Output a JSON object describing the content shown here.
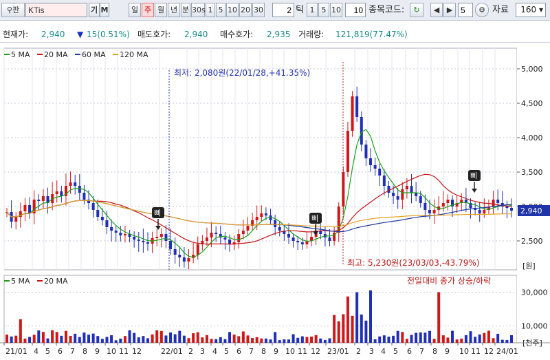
{
  "toolbar": {
    "search_icon_label": "ㅋ",
    "search_btn_label": "판",
    "stock_name": "KTis",
    "ki_label": "기",
    "m_label": "M",
    "period_buttons": [
      "일",
      "주",
      "월",
      "년",
      "분",
      "30s",
      "1",
      "5",
      "10",
      "20",
      "30"
    ],
    "active_period": "주",
    "count_value": "2",
    "tick_label": "틱",
    "tick_buttons": [
      "1",
      "5",
      "10"
    ],
    "tick_value": "10",
    "code_label": "종목코드:",
    "nav_value": "5",
    "data_label": "자료",
    "data_count": "160"
  },
  "info": {
    "price_label": "현재가:",
    "price": "2,940",
    "change": "15(0.51%)",
    "ask_label": "매도호가:",
    "ask": "2,940",
    "bid_label": "매수호가:",
    "bid": "2,935",
    "volume_label": "거래량:",
    "volume": "121,819(77.47%)"
  },
  "legend": {
    "ma": [
      {
        "label": "5 MA",
        "color": "#1aa01a"
      },
      {
        "label": "20 MA",
        "color": "#c41414"
      },
      {
        "label": "60 MA",
        "color": "#1f3a9e"
      },
      {
        "label": "120 MA",
        "color": "#e8a020"
      }
    ],
    "vol": [
      {
        "label": "5 MA",
        "color": "#1aa01a"
      },
      {
        "label": "20 MA",
        "color": "#c41414"
      }
    ],
    "vol_note": "전일대비 종가 상승/하락"
  },
  "annotations": {
    "low": "최저: 2,080원(22/01/28,+41.35%)",
    "high": "최고: 5,230원(23/03/03,-43.79%)",
    "markers": [
      "삐",
      "삐",
      "삐"
    ]
  },
  "chart_data": {
    "type": "candlestick",
    "price_axis": {
      "ticks": [
        "5,000",
        "4,500",
        "4,000",
        "3,500",
        "3,000",
        "2,500"
      ],
      "unit": "[원]",
      "range": [
        2080,
        5300
      ],
      "current": "2,940"
    },
    "volume_axis": {
      "ticks": [
        "30,000",
        "10,000"
      ],
      "unit": "[천주]",
      "range": [
        0,
        40000
      ]
    },
    "x_ticks": [
      "21/01",
      "4",
      "5",
      "6",
      "7",
      "8",
      "9",
      "10",
      "11",
      "12",
      "22/01",
      "2",
      "3",
      "4",
      "5",
      "6",
      "7",
      "8",
      "9",
      "10",
      "11",
      "12",
      "23/01",
      "2",
      "3",
      "4",
      "5",
      "6",
      "7",
      "8",
      "9",
      "10",
      "11",
      "12",
      "24/01"
    ],
    "key_values": {
      "low": 2080,
      "high": 5230,
      "last_close": 2940,
      "change": -15
    },
    "weekly_close": [
      2920,
      2780,
      2850,
      2930,
      3020,
      2900,
      3100,
      3080,
      3150,
      3050,
      3180,
      3220,
      3150,
      3300,
      3350,
      3300,
      3200,
      3100,
      3050,
      2950,
      2850,
      2800,
      2700,
      2650,
      2620,
      2580,
      2600,
      2560,
      2520,
      2500,
      2480,
      2460,
      2540,
      2560,
      2600,
      2500,
      2380,
      2300,
      2260,
      2200,
      2250,
      2300,
      2450,
      2500,
      2550,
      2620,
      2600,
      2550,
      2520,
      2450,
      2480,
      2600,
      2650,
      2720,
      2800,
      2850,
      2900,
      2870,
      2800,
      2700,
      2650,
      2600,
      2550,
      2500,
      2480,
      2450,
      2500,
      2560,
      2650,
      2600,
      2550,
      2500,
      2620,
      3000,
      3500,
      4100,
      4600,
      4300,
      3900,
      3700,
      3600,
      3550,
      3450,
      3300,
      3200,
      3150,
      3100,
      3250,
      3300,
      3200,
      3150,
      3050,
      2950,
      2900,
      2950,
      3000,
      3050,
      3100,
      3000,
      3050,
      3100,
      3050,
      2980,
      2950,
      2900,
      2950,
      3000,
      3100,
      3050,
      3000,
      2980,
      2940
    ],
    "ma_series": [
      {
        "name": "5 MA"
      },
      {
        "name": "20 MA"
      },
      {
        "name": "60 MA"
      },
      {
        "name": "120 MA"
      }
    ]
  }
}
